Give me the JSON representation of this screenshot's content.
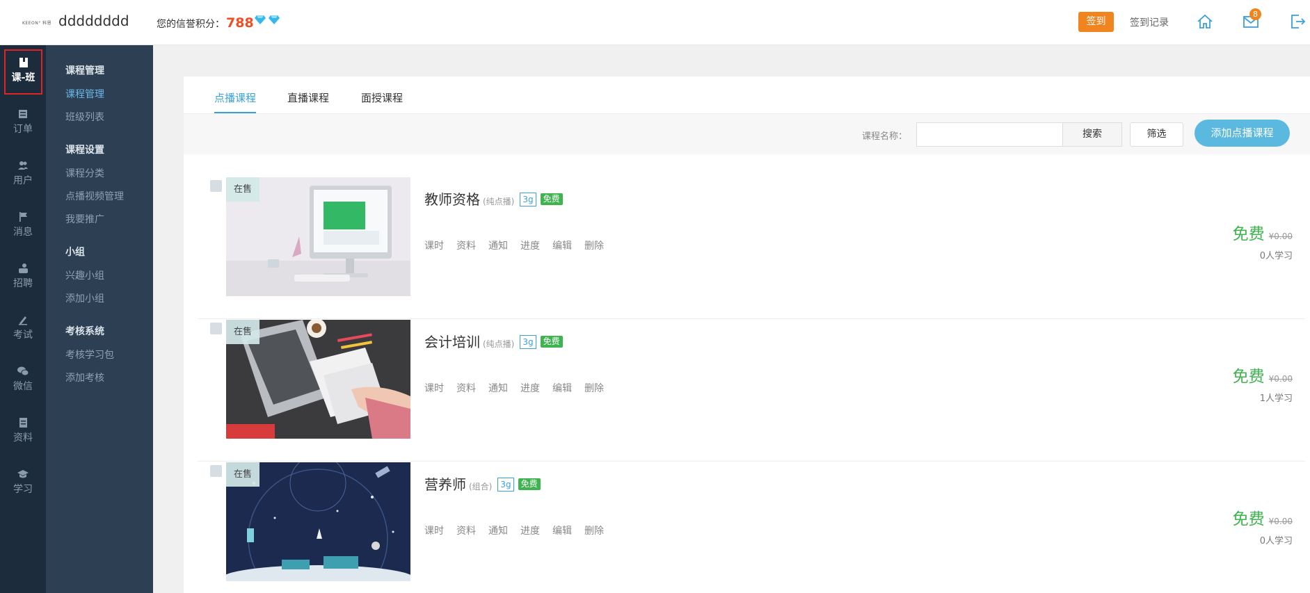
{
  "header": {
    "logo_text": "KEEON° 科恩",
    "site_name": "dddddddd",
    "credit_label": "您的信誉积分：",
    "credit_score": "788",
    "signin_label": "签到",
    "signin_log_label": "签到记录",
    "message_count": "8"
  },
  "iconbar": {
    "items": [
      {
        "label": "课-班",
        "icon": "book-icon"
      },
      {
        "label": "订单",
        "icon": "order-icon"
      },
      {
        "label": "用户",
        "icon": "users-icon"
      },
      {
        "label": "消息",
        "icon": "flag-icon"
      },
      {
        "label": "招聘",
        "icon": "recruit-icon"
      },
      {
        "label": "考试",
        "icon": "pen-icon"
      },
      {
        "label": "微信",
        "icon": "wechat-icon"
      },
      {
        "label": "资料",
        "icon": "file-icon"
      },
      {
        "label": "学习",
        "icon": "graduation-cap-icon"
      }
    ]
  },
  "submenu": {
    "groups": [
      {
        "title": "课程管理",
        "links": [
          "课程管理",
          "班级列表"
        ]
      },
      {
        "title": "课程设置",
        "links": [
          "课程分类",
          "点播视频管理",
          "我要推广"
        ]
      },
      {
        "title": "小组",
        "links": [
          "兴趣小组",
          "添加小组"
        ]
      },
      {
        "title": "考核系统",
        "links": [
          "考核学习包",
          "添加考核"
        ]
      }
    ]
  },
  "tabs": [
    "点播课程",
    "直播课程",
    "面授课程"
  ],
  "toolbar": {
    "search_label": "课程名称：",
    "search_value": "",
    "search_button": "搜索",
    "filter_button": "筛选",
    "add_button": "添加点播课程"
  },
  "courses": [
    {
      "status": "在售",
      "title": "教师资格",
      "subtitle": "(纯点播)",
      "tag_network": "3g",
      "tag_free": "免费",
      "actions": [
        "课时",
        "资料",
        "通知",
        "进度",
        "编辑",
        "删除"
      ],
      "price": "免费",
      "original_price": "¥0.00",
      "learners": "0人学习"
    },
    {
      "status": "在售",
      "title": "会计培训",
      "subtitle": "(纯点播)",
      "tag_network": "3g",
      "tag_free": "免费",
      "actions": [
        "课时",
        "资料",
        "通知",
        "进度",
        "编辑",
        "删除"
      ],
      "price": "免费",
      "original_price": "¥0.00",
      "learners": "1人学习"
    },
    {
      "status": "在售",
      "title": "营养师",
      "subtitle": "(组合)",
      "tag_network": "3g",
      "tag_free": "免费",
      "actions": [
        "课时",
        "资料",
        "通知",
        "进度",
        "编辑",
        "删除"
      ],
      "price": "免费",
      "original_price": "¥0.00",
      "learners": "0人学习"
    }
  ],
  "colors": {
    "accent_orange": "#f08520",
    "accent_blue": "#3aa0d8",
    "free_green": "#3fb34f",
    "sidebar_dark": "#1c2c3c",
    "submenu_bg": "#2d3f52"
  }
}
